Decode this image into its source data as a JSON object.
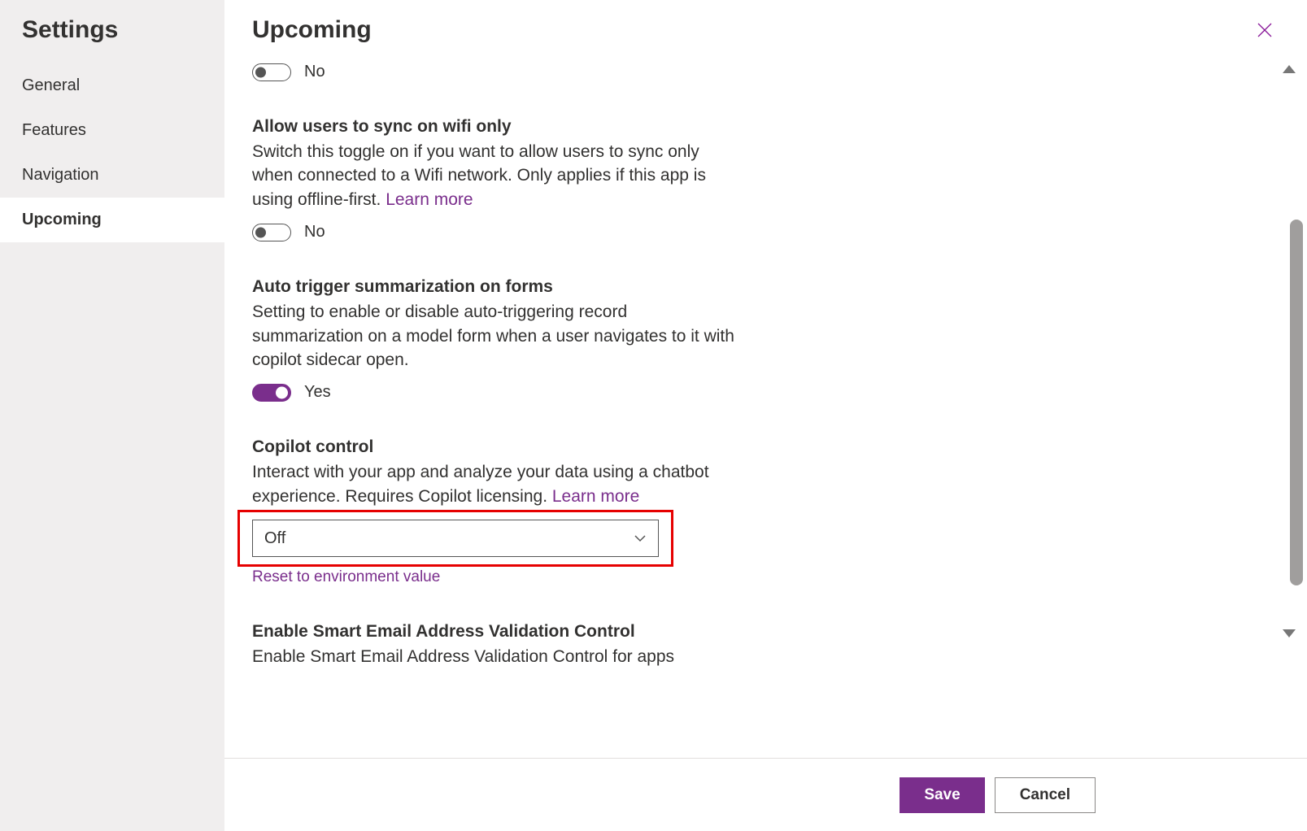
{
  "sidebar": {
    "title": "Settings",
    "items": [
      {
        "label": "General",
        "active": false
      },
      {
        "label": "Features",
        "active": false
      },
      {
        "label": "Navigation",
        "active": false
      },
      {
        "label": "Upcoming",
        "active": true
      }
    ]
  },
  "header": {
    "title": "Upcoming"
  },
  "settings": {
    "untitled_toggle": {
      "state": "off",
      "label": "No"
    },
    "wifi": {
      "title": "Allow users to sync on wifi only",
      "desc": "Switch this toggle on if you want to allow users to sync only when connected to a Wifi network. Only applies if this app is using offline-first. ",
      "link": "Learn more",
      "state": "off",
      "label": "No"
    },
    "summarization": {
      "title": "Auto trigger summarization on forms",
      "desc": "Setting to enable or disable auto-triggering record summarization on a model form when a user navigates to it with copilot sidecar open.",
      "state": "on",
      "label": "Yes"
    },
    "copilot": {
      "title": "Copilot control",
      "desc": "Interact with your app and analyze your data using a chatbot experience. Requires Copilot licensing. ",
      "link": "Learn more",
      "value": "Off",
      "reset": "Reset to environment value"
    },
    "smartemail": {
      "title": "Enable Smart Email Address Validation Control",
      "desc": "Enable Smart Email Address Validation Control for apps"
    }
  },
  "footer": {
    "save": "Save",
    "cancel": "Cancel"
  },
  "colors": {
    "accent": "#7a2e8c",
    "highlight": "#e60000"
  }
}
